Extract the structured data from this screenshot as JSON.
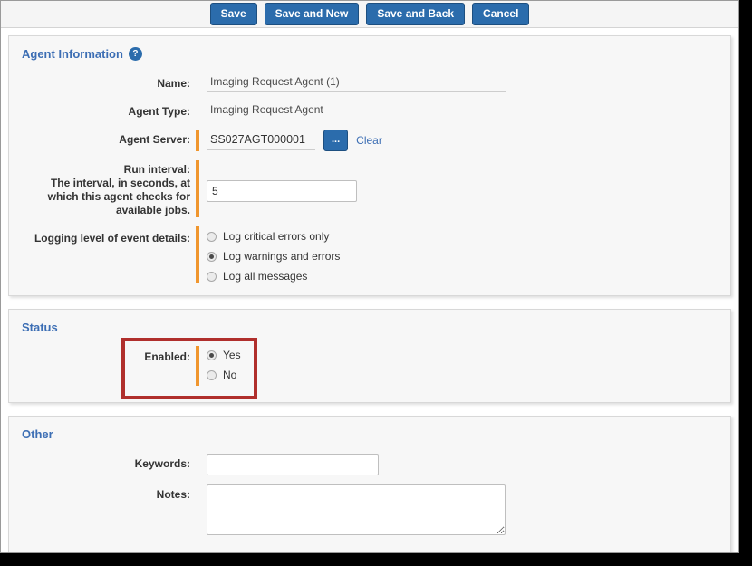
{
  "toolbar": {
    "buttons": [
      {
        "label": "Save",
        "name": "save-button"
      },
      {
        "label": "Save and New",
        "name": "save-and-new-button"
      },
      {
        "label": "Save and Back",
        "name": "save-and-back-button"
      },
      {
        "label": "Cancel",
        "name": "cancel-button"
      }
    ]
  },
  "colors": {
    "accent_blue": "#2b6cac",
    "heading_blue": "#3c6eb4",
    "required_orange": "#f0962e",
    "annotation_red": "#b02f2c",
    "panel_bg": "#f7f7f7"
  },
  "agent_information": {
    "title": "Agent Information",
    "help_icon": "help-question-icon",
    "help_glyph": "?",
    "name": {
      "label": "Name:",
      "value": "Imaging Request Agent (1)",
      "placeholder": ""
    },
    "agent_type": {
      "label": "Agent Type:",
      "value": "Imaging Request Agent",
      "placeholder": ""
    },
    "agent_server": {
      "label": "Agent Server:",
      "value": "SS027AGT000001",
      "placeholder": "",
      "browse_label": "...",
      "clear_label": "Clear",
      "required": true
    },
    "run_interval": {
      "label_line1": "Run interval:",
      "label_line2": "The interval, in seconds, at",
      "label_line3": "which this agent checks for",
      "label_line4": "available jobs.",
      "value": "5",
      "placeholder": "",
      "required": true
    },
    "logging_level": {
      "label": "Logging level of event details:",
      "required": true,
      "options": [
        {
          "label": "Log critical errors only",
          "selected": false
        },
        {
          "label": "Log warnings and errors",
          "selected": true
        },
        {
          "label": "Log all messages",
          "selected": false
        }
      ]
    }
  },
  "status": {
    "title": "Status",
    "enabled": {
      "label": "Enabled:",
      "required": true,
      "options": [
        {
          "label": "Yes",
          "selected": true
        },
        {
          "label": "No",
          "selected": false
        }
      ]
    },
    "annotation": "red-highlight-box"
  },
  "other": {
    "title": "Other",
    "keywords": {
      "label": "Keywords:",
      "value": "",
      "placeholder": ""
    },
    "notes": {
      "label": "Notes:",
      "value": "",
      "placeholder": ""
    }
  }
}
